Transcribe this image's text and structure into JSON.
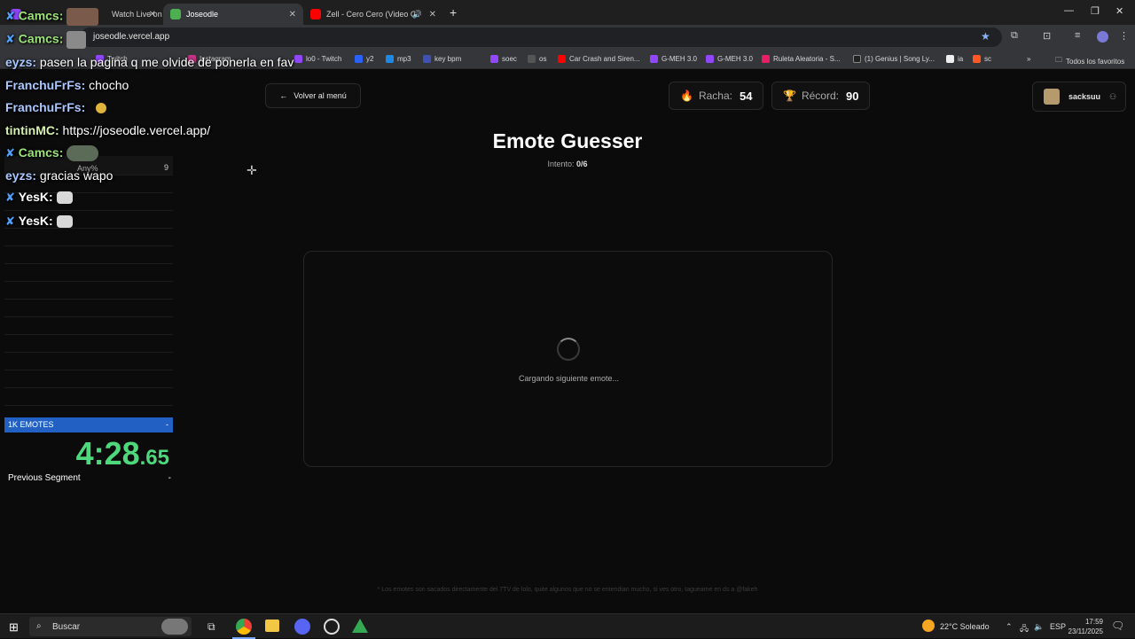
{
  "browser": {
    "tabs": [
      {
        "label": "Watch Live on",
        "favicon_color": "#9146ff"
      },
      {
        "label": "Joseodle",
        "favicon_color": "#4caf50"
      },
      {
        "label": "Zell - Cero Cero (Video Ofic",
        "favicon_color": "#ff0000"
      }
    ],
    "url": "joseodle.vercel.app",
    "bookmarks": [
      "Twitch",
      "Instagram",
      "lo0 - Twitch",
      "y2",
      "mp3",
      "key bpm",
      "soec",
      "os",
      "Car Crash and Siren...",
      "G-MEH 3.0",
      "G-MEH 3.0",
      "Ruleta Aleatoria - S...",
      "(1) Genius | Song Ly...",
      "ia",
      "sc"
    ],
    "all_bookmarks_label": "Todos los favoritos"
  },
  "page": {
    "back_label": "Volver al menú",
    "streak_label": "Racha:",
    "streak_value": "54",
    "record_label": "Récord:",
    "record_value": "90",
    "username": "sacksuu",
    "title": "Emote Guesser",
    "attempts_label": "Intento:",
    "attempts_value": "0/6",
    "loading_text": "Cargando siguiente emote...",
    "footnote": "* Los emotes son sacados directamente del 7TV de lolo, quite algunos que no se entendian mucho, si ves otro, tagueame en ds a @fakeh"
  },
  "overlay": {
    "chat": [
      {
        "user": "Camcs:",
        "msg": "",
        "badge": true
      },
      {
        "user": "Camcs:",
        "msg": "",
        "badge": true
      },
      {
        "user": "eyzs:",
        "msg": "pasen la pagina q me olvide de ponerla en fav",
        "badge": false
      },
      {
        "user": "FranchuFrFs:",
        "msg": "chocho",
        "badge": false
      },
      {
        "user": "FranchuFrFs:",
        "msg": "",
        "badge": false
      },
      {
        "user": "tintinMC:",
        "msg": "https://joseodle.vercel.app/",
        "badge": false
      },
      {
        "user": "Camcs:",
        "msg": "",
        "badge": true
      },
      {
        "user": "eyzs:",
        "msg": "gracias wapo",
        "badge": false
      },
      {
        "user": "YesK:",
        "msg": "",
        "badge": true
      },
      {
        "user": "YesK:",
        "msg": "",
        "badge": true
      }
    ],
    "splits": {
      "category": "Any%",
      "attempt_count": "9",
      "segment_name": "1K EMOTES",
      "segment_delta": "-",
      "timer_main": "4:28",
      "timer_ms": ".65",
      "previous_segment_label": "Previous Segment",
      "previous_segment_value": "-"
    }
  },
  "taskbar": {
    "search_label": "Buscar",
    "weather": "22°C",
    "weather_desc": "Soleado",
    "lang": "ESP",
    "time": "17:59",
    "date": "23/11/2025"
  }
}
